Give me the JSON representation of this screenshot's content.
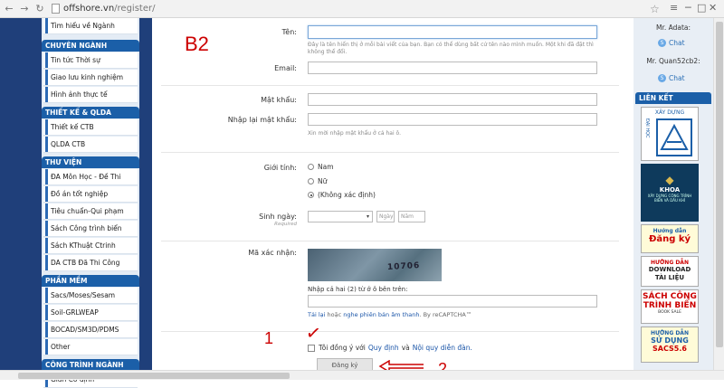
{
  "browser": {
    "url_domain": "offshore.vn",
    "url_path": "/register/"
  },
  "sidebar": {
    "top_item": "Tìm hiểu về Ngành",
    "sections": [
      {
        "title": "CHUYÊN NGÀNH",
        "items": [
          "Tin tức Thời sự",
          "Giao lưu kinh nghiệm",
          "Hình ảnh thực tế"
        ]
      },
      {
        "title": "THIẾT KẾ & QLDA",
        "items": [
          "Thiết kế CTB",
          "QLDA CTB"
        ]
      },
      {
        "title": "THƯ VIỆN",
        "items": [
          "ĐA Môn Học - Đề Thi",
          "Đồ án tốt nghiệp",
          "Tiêu chuẩn-Qui phạm",
          "Sách Công trình biển",
          "Sách KThuật Ctrinh",
          "DA CTB Đã Thi Công"
        ]
      },
      {
        "title": "PHẦN MỀM",
        "items": [
          "Sacs/Moses/Sesam",
          "Soil-GRLWEAP",
          "BOCAD/SM3D/PDMS",
          "Other"
        ]
      },
      {
        "title": "CÔNG TRÌNH NGÀNH",
        "items": [
          "Giàn Cố định"
        ]
      }
    ]
  },
  "form": {
    "step_label": "B2",
    "name_label": "Tên:",
    "name_hint": "Đây là tên hiển thị ở mỗi bài viết của bạn. Bạn có thể dùng bất cứ tên nào mình muốn. Một khi đã đặt thì không thể đổi.",
    "email_label": "Email:",
    "password_label": "Mật khẩu:",
    "confirm_label": "Nhập lại mật khẩu:",
    "password_hint": "Xin mời nhập mật khẩu ở cả hai ô.",
    "gender_label": "Giới tính:",
    "gender_options": [
      "Nam",
      "Nữ",
      "(Không xác định)"
    ],
    "gender_selected": 2,
    "dob_label": "Sinh ngày:",
    "dob_required": "Required",
    "dob_day": "Ngày",
    "dob_year": "Năm",
    "captcha_label": "Mã xác nhận:",
    "captcha_text": "10706",
    "captcha_prompt": "Nhập cả hai (2) từ ở ô bên trên:",
    "captcha_reload": "Tải lại",
    "captcha_or": "hoặc",
    "captcha_audio": "nghe phiên bản âm thanh",
    "captcha_by": ". By reCAPTCHA™",
    "agree_prefix": "Tôi đồng ý với",
    "agree_rules": "Quy định",
    "agree_and": "và",
    "agree_policy": "Nội quy diễn đàn.",
    "submit_label": "Đăng ký"
  },
  "annotations": {
    "one": "1",
    "two": "2",
    "check": "✓"
  },
  "right_panel": {
    "users": [
      {
        "name": "Mr. Adata:",
        "chat": "Chat"
      },
      {
        "name": "Mr. Quan52cb2:",
        "chat": "Chat"
      }
    ],
    "links_title": "LIÊN KẾT",
    "banners": [
      {
        "line1": "XÂY DỰNG",
        "line2": "ĐẠI HỌC"
      },
      {
        "line1": "KHOA",
        "line2": "XÂY DỰNG CÔNG TRÌNH BIỂN VÀ DẦU KHÍ"
      },
      {
        "line1": "Hướng dẫn",
        "line2": "Đăng ký"
      },
      {
        "line1": "HƯỚNG DẪN",
        "line2": "DOWNLOAD TÀI LIỆU"
      },
      {
        "line1": "SÁCH CÔNG",
        "line2": "TRÌNH BIỂN",
        "line3": "BOOK SALE"
      },
      {
        "line1": "HƯỚNG DẪN",
        "line2": "SỬ DỤNG",
        "line3": "SACS5.6"
      }
    ]
  }
}
